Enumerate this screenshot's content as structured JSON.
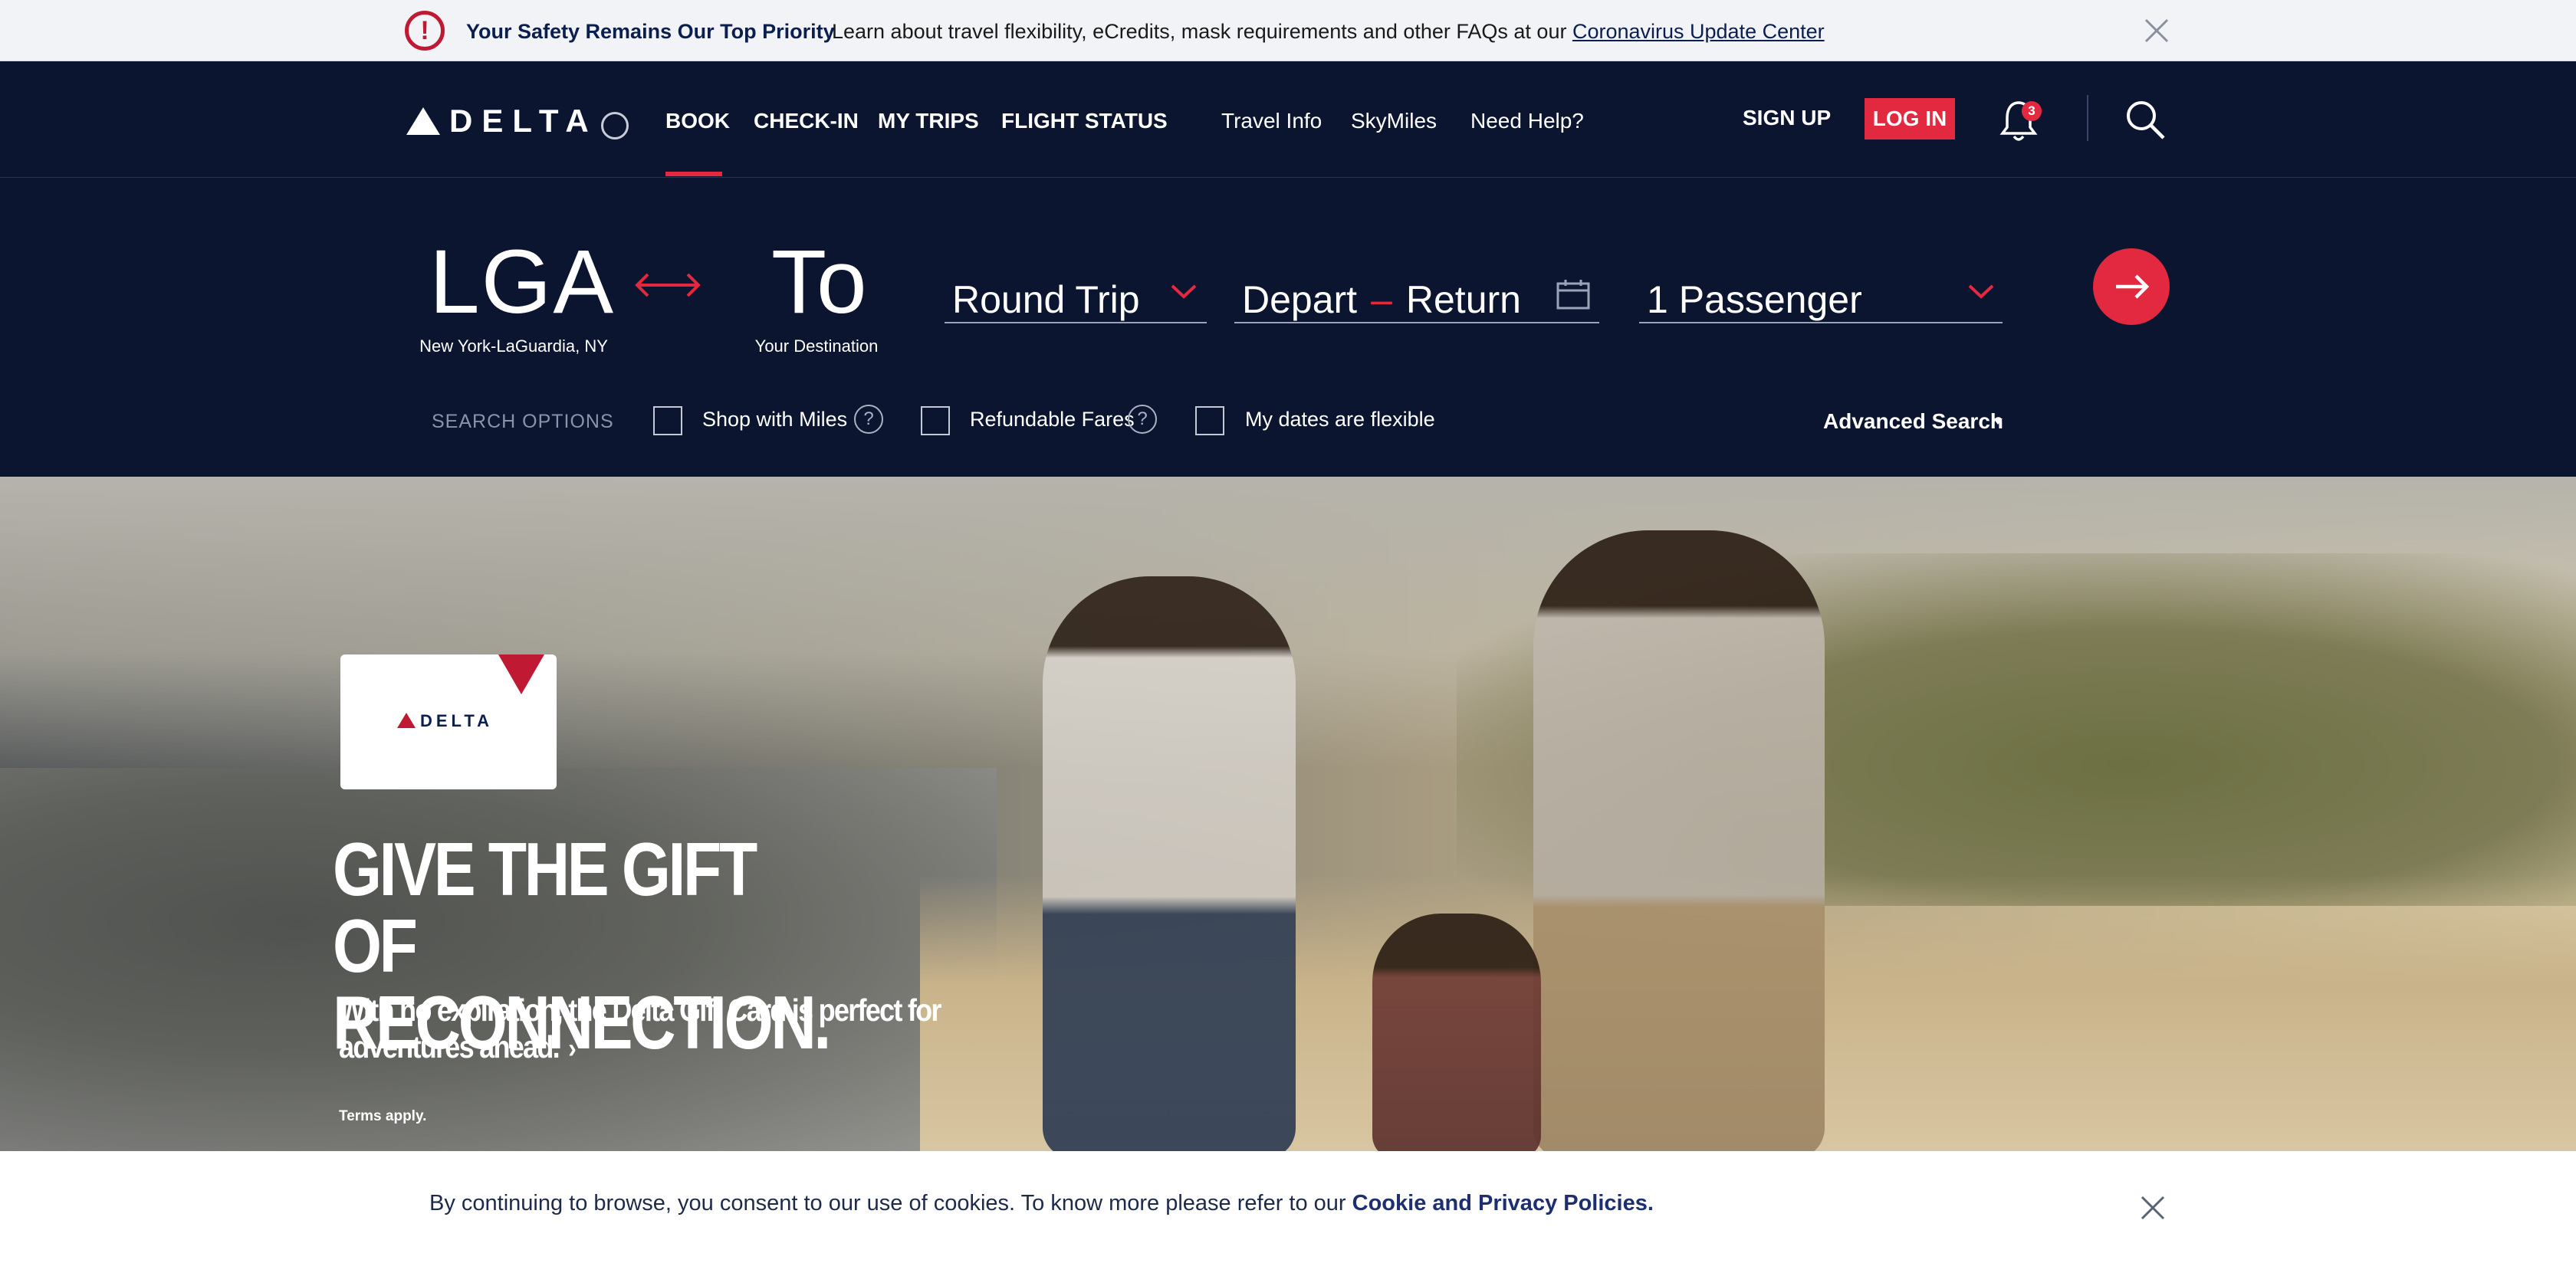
{
  "alert": {
    "title": "Your Safety Remains Our Top Priority",
    "text": "Learn about travel flexibility, eCredits, mask requirements and other FAQs at our ",
    "link": "Coronavirus Update Center",
    "icon": "!"
  },
  "header": {
    "logo_text": "DELTA",
    "nav": [
      "BOOK",
      "CHECK-IN",
      "MY TRIPS",
      "FLIGHT STATUS"
    ],
    "secondary_nav": [
      "Travel Info",
      "SkyMiles",
      "Need Help?"
    ],
    "sign_up": "SIGN UP",
    "log_in": "LOG IN",
    "notification_count": "3"
  },
  "booking": {
    "from_code": "LGA",
    "from_name": "New York-LaGuardia, NY",
    "to_code": "To",
    "to_name": "Your Destination",
    "trip_type": "Round Trip",
    "depart": "Depart",
    "return": "Return",
    "passengers": "1 Passenger",
    "search_options_label": "SEARCH OPTIONS",
    "options": [
      "Shop with Miles",
      "Refundable Fares",
      "My dates are flexible"
    ],
    "help_glyph": "?",
    "advanced_search": "Advanced Search"
  },
  "hero": {
    "card_logo": "DELTA",
    "title_line1": "GIVE THE GIFT",
    "title_line2": "OF RECONNECTION.",
    "subtitle": "With no expiration, the Delta Gift Card is perfect for adventures ahead.",
    "chevron": "›",
    "terms": "Terms apply."
  },
  "cookie": {
    "text": "By continuing to browse, you consent to our use of cookies. To know more please refer to our ",
    "link": "Cookie and Privacy Policies."
  },
  "colors": {
    "navy": "#0b1530",
    "red": "#e2293f",
    "alert_red": "#c01933"
  }
}
